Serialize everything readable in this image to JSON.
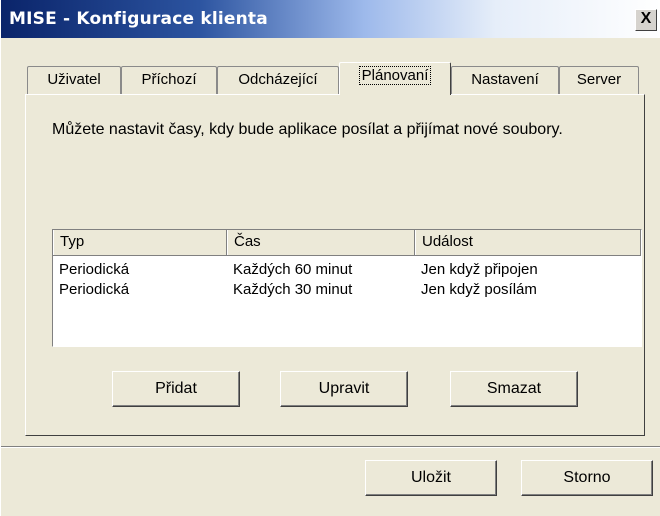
{
  "window": {
    "title": "MISE - Konfigurace klienta",
    "close_glyph": "X"
  },
  "tabs": [
    {
      "label": "Uživatel"
    },
    {
      "label": "Příchozí"
    },
    {
      "label": "Odcházející"
    },
    {
      "label": "Plánovaní"
    },
    {
      "label": "Nastavení"
    },
    {
      "label": "Server"
    }
  ],
  "active_tab": "Plánovaní",
  "panel": {
    "description": "Můžete nastavit časy, kdy bude aplikace posílat a přijímat nové soubory."
  },
  "list": {
    "columns": [
      "Typ",
      "Čas",
      "Událost"
    ],
    "rows": [
      [
        "Periodická",
        "Každých 60 minut",
        "Jen když připojen"
      ],
      [
        "Periodická",
        "Každých 30 minut",
        "Jen když posílám"
      ]
    ]
  },
  "buttons": {
    "add": "Přidat",
    "edit": "Upravit",
    "delete": "Smazat",
    "save": "Uložit",
    "cancel": "Storno"
  }
}
